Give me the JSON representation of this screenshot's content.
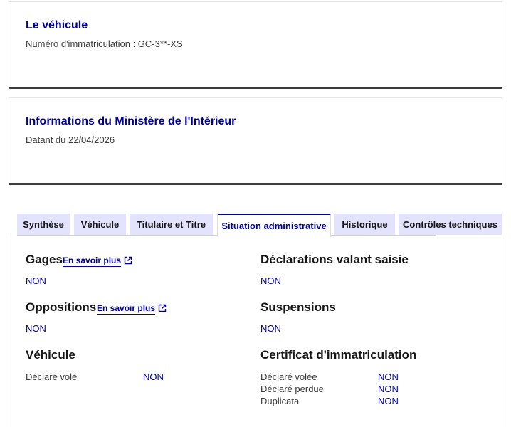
{
  "vehicle_card": {
    "title": "Le véhicule",
    "plate_line": "Numéro d'immatriculation : GC-3**-XS"
  },
  "ministry_card": {
    "title": "Informations du Ministère de l'Intérieur",
    "date_line": "Datant du 22/04/2026"
  },
  "tabs": [
    {
      "label": "Synthèse"
    },
    {
      "label": "Véhicule"
    },
    {
      "label": "Titulaire et Titre"
    },
    {
      "label": "Situation administrative",
      "active": true
    },
    {
      "label": "Historique"
    },
    {
      "label": "Contrôles techniques"
    }
  ],
  "left": {
    "gages": {
      "title": "Gages",
      "link": "En savoir plus",
      "value": "NON"
    },
    "oppositions": {
      "title": "Oppositions",
      "link": "En savoir plus",
      "value": "NON"
    },
    "vehicule": {
      "title": "Véhicule",
      "rows": [
        {
          "label": "Déclaré volé",
          "value": "NON"
        }
      ]
    }
  },
  "right": {
    "saisie": {
      "title": "Déclarations valant saisie",
      "value": "NON"
    },
    "suspensions": {
      "title": "Suspensions",
      "value": "NON"
    },
    "certificat": {
      "title": "Certificat d'immatriculation",
      "rows": [
        {
          "label": "Déclaré volée",
          "value": "NON"
        },
        {
          "label": "Déclaré perdue",
          "value": "NON"
        },
        {
          "label": "Duplicata",
          "value": "NON"
        }
      ]
    }
  },
  "colors": {
    "accent_blue": "#000091",
    "tab_inactive_bg": "#e3e3fd",
    "card_bottom_border": "#3a3a3a"
  },
  "icons": {
    "external_link": "external-link-icon"
  }
}
